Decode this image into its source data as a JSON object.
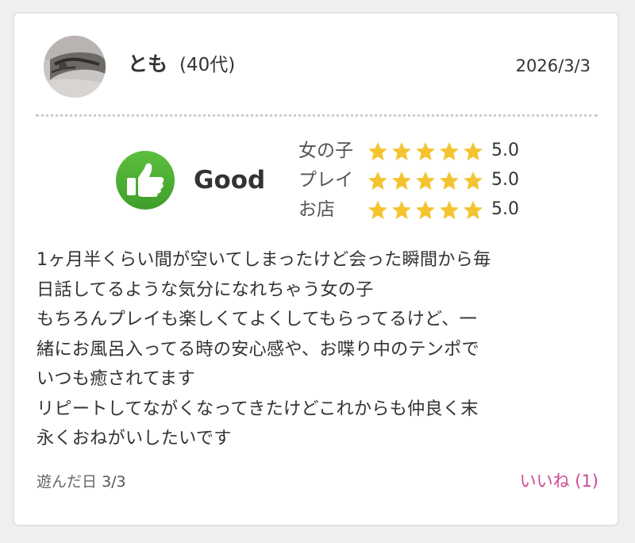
{
  "review": {
    "user": {
      "name": "とも",
      "age_group": "(40代)",
      "avatar": "user-avatar-photo"
    },
    "date": "2026/3/3",
    "overall": {
      "icon": "thumbs-up-icon",
      "label": "Good",
      "icon_color": "#4caf35"
    },
    "ratings": [
      {
        "label": "女の子",
        "stars": 5,
        "score": "5.0"
      },
      {
        "label": "プレイ",
        "stars": 5,
        "score": "5.0"
      },
      {
        "label": "お店",
        "stars": 5,
        "score": "5.0"
      }
    ],
    "star_color": "#f4c430",
    "body_lines": [
      "1ヶ月半くらい間が空いてしまったけど会った瞬間から毎",
      "日話してるような気分になれちゃう女の子",
      "もちろんプレイも楽しくてよくしてもらってるけど、一",
      "緒にお風呂入ってる時の安心感や、お喋り中のテンポで",
      "いつも癒されてます",
      "リピートしてながくなってきたけどこれからも仲良く末",
      "永くおねがいしたいです"
    ],
    "played": {
      "label": "遊んだ日",
      "value": "3/3"
    },
    "like": {
      "label": "いいね (1)",
      "color": "#cc4a94"
    }
  }
}
